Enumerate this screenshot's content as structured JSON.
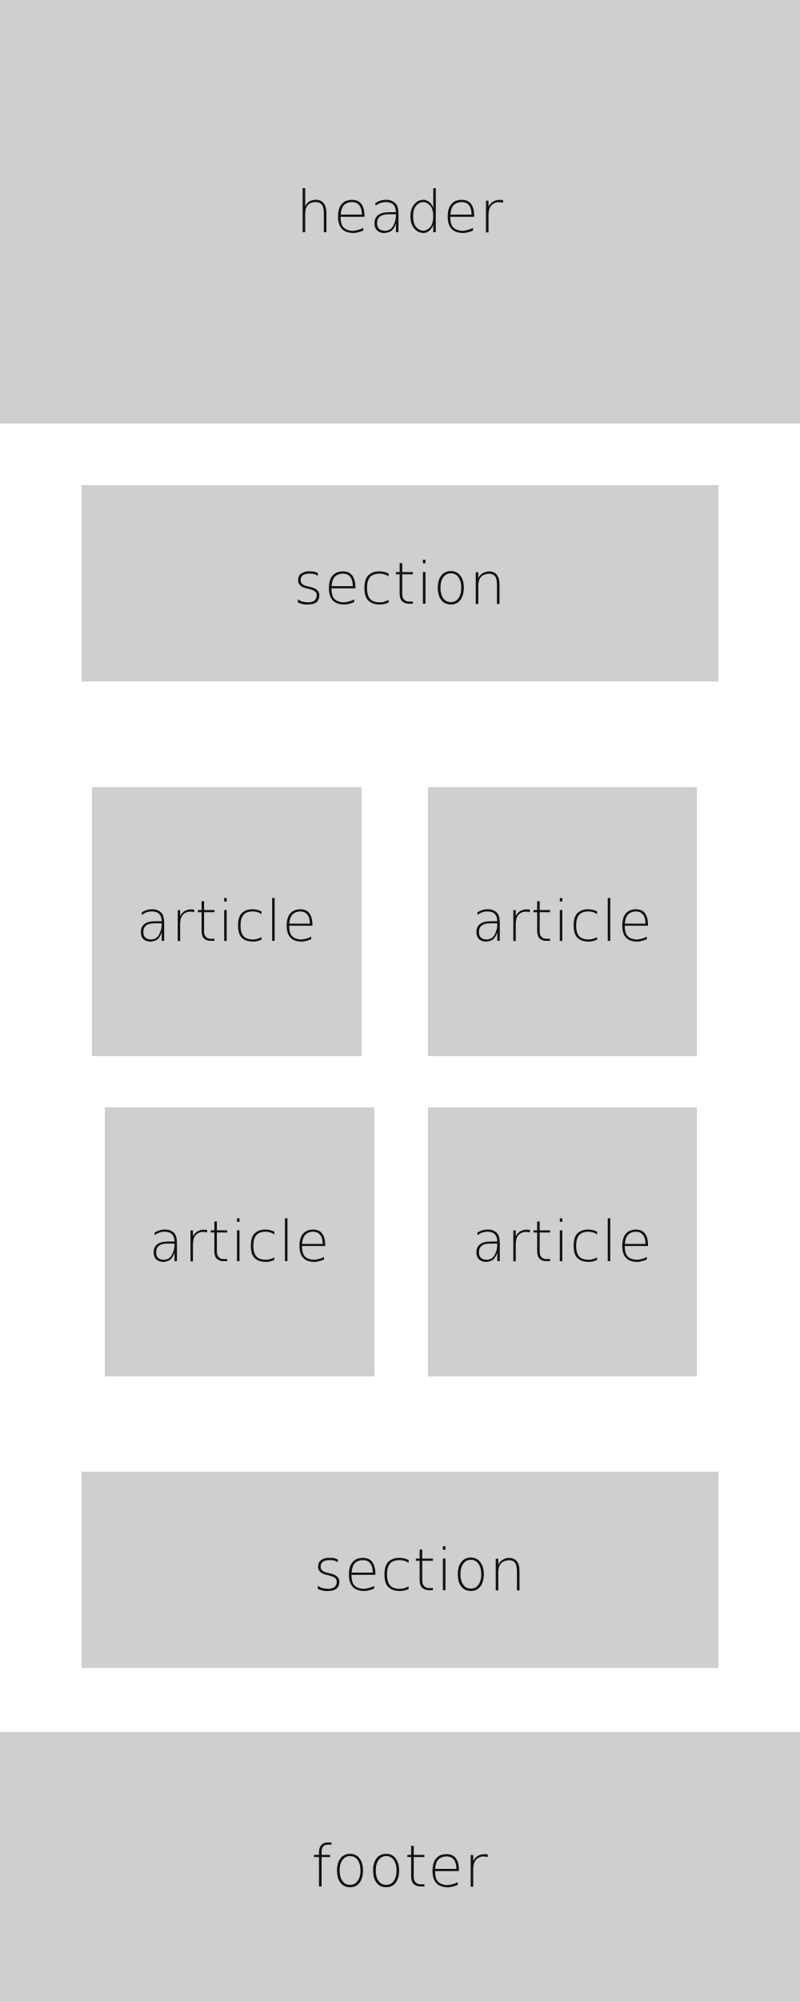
{
  "header": {
    "label": "header"
  },
  "sections": [
    {
      "label": "section"
    },
    {
      "label": "section"
    }
  ],
  "articles": [
    {
      "label": "article"
    },
    {
      "label": "article"
    },
    {
      "label": "article"
    },
    {
      "label": "article"
    }
  ],
  "footer": {
    "label": "footer"
  },
  "colors": {
    "block_fill": "#cfcfcf",
    "background": "#ffffff",
    "text": "#111111"
  }
}
